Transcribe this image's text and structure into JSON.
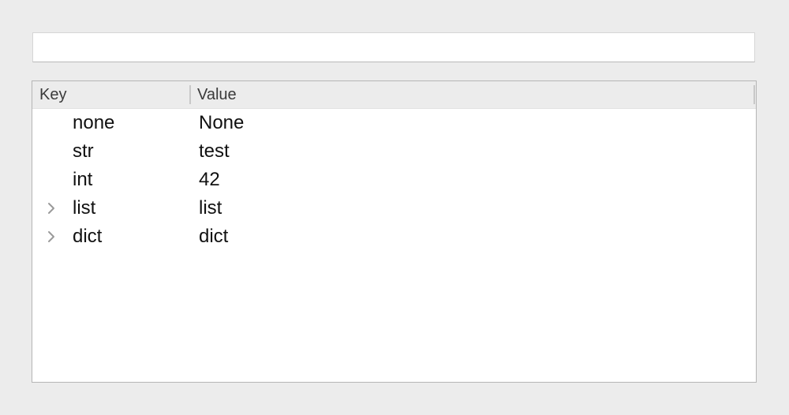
{
  "search": {
    "value": "",
    "placeholder": ""
  },
  "tree": {
    "columns": {
      "key": "Key",
      "value": "Value"
    },
    "rows": [
      {
        "key": "none",
        "value": "None",
        "expandable": false
      },
      {
        "key": "str",
        "value": "test",
        "expandable": false
      },
      {
        "key": "int",
        "value": "42",
        "expandable": false
      },
      {
        "key": "list",
        "value": "list",
        "expandable": true
      },
      {
        "key": "dict",
        "value": "dict",
        "expandable": true
      }
    ]
  },
  "colors": {
    "window_background": "#ececec",
    "header_background": "#ececec",
    "content_background": "#ffffff",
    "expander_arrow": "#9a9a9a"
  },
  "icons": {
    "expander": "chevron-right-icon"
  }
}
